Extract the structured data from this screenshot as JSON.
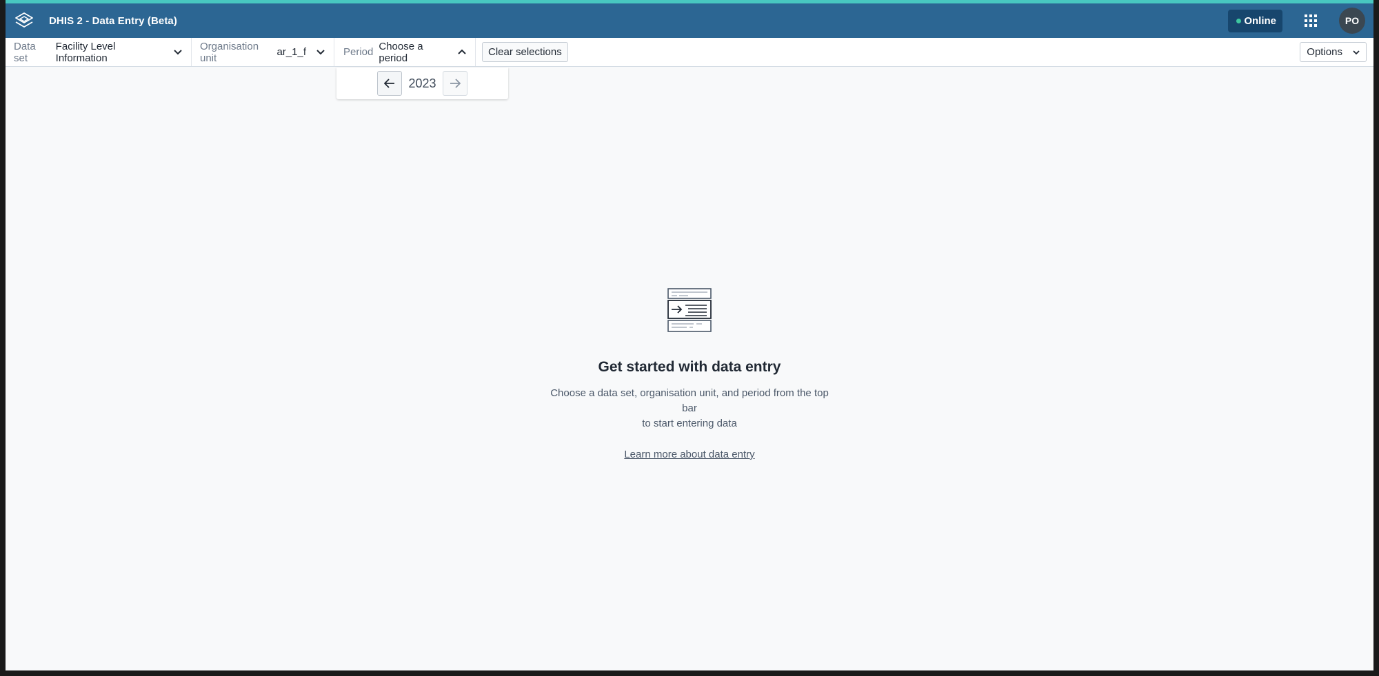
{
  "header": {
    "app_title": "DHIS 2 - Data Entry (Beta)",
    "status": "Online",
    "status_color": "#3ec8a0",
    "avatar_initials": "PO",
    "brand_color": "#2c6693",
    "accent_color": "#48c7c0",
    "logo_icon": "dhis2-logo-icon",
    "apps_icon": "apps-grid-icon"
  },
  "context": {
    "dataset_label": "Data set",
    "dataset_value": "Facility Level Information",
    "orgunit_label": "Organisation unit",
    "orgunit_value": "ar_1_f",
    "period_label": "Period",
    "period_value": "Choose a period",
    "clear_label": "Clear selections",
    "options_label": "Options"
  },
  "period_picker": {
    "year": "2023",
    "prev_icon": "arrow-left-icon",
    "next_icon": "arrow-right-icon"
  },
  "empty_state": {
    "icon": "data-entry-form-icon",
    "title": "Get started with data entry",
    "description_line1": "Choose a data set, organisation unit, and period from the top bar",
    "description_line2": "to start entering data",
    "link": "Learn more about data entry"
  }
}
